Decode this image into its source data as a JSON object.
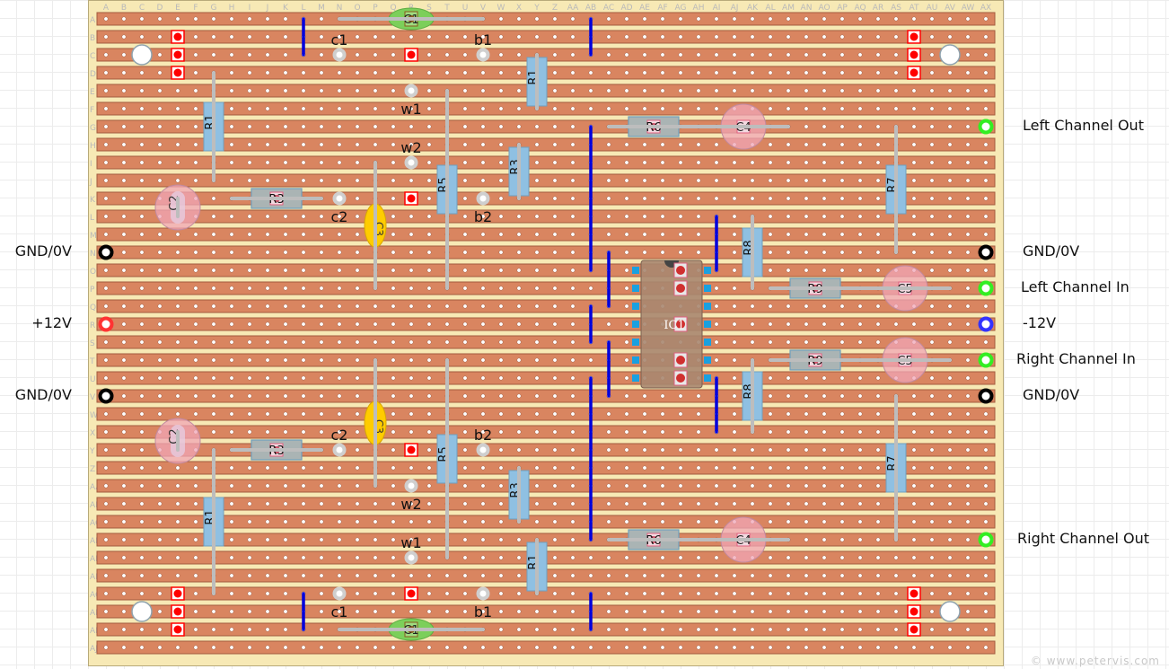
{
  "board": {
    "columns": [
      "A",
      "B",
      "C",
      "D",
      "E",
      "F",
      "G",
      "H",
      "I",
      "J",
      "K",
      "L",
      "M",
      "N",
      "O",
      "P",
      "Q",
      "R",
      "S",
      "T",
      "U",
      "V",
      "W",
      "X",
      "Y",
      "Z",
      "AA",
      "AB",
      "AC",
      "AD",
      "AE",
      "AF",
      "AG",
      "AH",
      "AI",
      "AJ",
      "AK",
      "AL",
      "AM",
      "AN",
      "AO",
      "AP",
      "AQ",
      "AR",
      "AS",
      "AT",
      "AU",
      "AV",
      "AW",
      "AX"
    ],
    "rows": [
      "A",
      "B",
      "C",
      "D",
      "E",
      "F",
      "G",
      "H",
      "I",
      "J",
      "K",
      "L",
      "M",
      "N",
      "O",
      "P",
      "Q",
      "R",
      "S",
      "T",
      "U",
      "V",
      "W",
      "X",
      "Y",
      "Z",
      "AA",
      "AB",
      "AC",
      "AD",
      "AE",
      "AF",
      "AG",
      "AH",
      "AI",
      "AJ"
    ],
    "colors": {
      "strip": "#d98560",
      "strip_border": "#a35a3e",
      "board": "#f7e9b5",
      "link": "#0000dd",
      "resistor": "#8fc0e2",
      "resistor_flat": "#aab4b4",
      "electrolytic": "#f0a6b6",
      "ceramic": "#ffcc00",
      "film": "#7ccf5a",
      "ic": "#a98770",
      "cut": "#ff0000"
    }
  },
  "external_labels": [
    {
      "text": "Left Channel Out",
      "side": "right",
      "row": "G"
    },
    {
      "text": "GND/0V",
      "side": "right",
      "row": "N"
    },
    {
      "text": "Left Channel In",
      "side": "right",
      "row": "P"
    },
    {
      "text": "-12V",
      "side": "right",
      "row": "R"
    },
    {
      "text": "Right Channel In",
      "side": "right",
      "row": "T"
    },
    {
      "text": "GND/0V",
      "side": "right",
      "row": "V"
    },
    {
      "text": "Right Channel Out",
      "side": "right",
      "row": "AD"
    },
    {
      "text": "GND/0V",
      "side": "left",
      "row": "N"
    },
    {
      "text": "+12V",
      "side": "left",
      "row": "R"
    },
    {
      "text": "GND/0V",
      "side": "left",
      "row": "V"
    }
  ],
  "terminals": [
    {
      "type": "ground",
      "col": "A",
      "row": "N",
      "color": "#000000"
    },
    {
      "type": "positive",
      "col": "A",
      "row": "R",
      "color": "#ff3333"
    },
    {
      "type": "ground",
      "col": "A",
      "row": "V",
      "color": "#000000"
    },
    {
      "type": "output",
      "col": "AX",
      "row": "G",
      "color": "#33ee22"
    },
    {
      "type": "ground",
      "col": "AX",
      "row": "N",
      "color": "#000000"
    },
    {
      "type": "input",
      "col": "AX",
      "row": "P",
      "color": "#33ee22"
    },
    {
      "type": "negative",
      "col": "AX",
      "row": "R",
      "color": "#3333ff"
    },
    {
      "type": "input",
      "col": "AX",
      "row": "T",
      "color": "#33ee22"
    },
    {
      "type": "ground",
      "col": "AX",
      "row": "V",
      "color": "#000000"
    },
    {
      "type": "output",
      "col": "AX",
      "row": "AD",
      "color": "#33ee22"
    }
  ],
  "track_cuts": [
    {
      "col": "E",
      "row": "B"
    },
    {
      "col": "E",
      "row": "C"
    },
    {
      "col": "E",
      "row": "D"
    },
    {
      "col": "R",
      "row": "C"
    },
    {
      "col": "AT",
      "row": "B"
    },
    {
      "col": "AT",
      "row": "C"
    },
    {
      "col": "AT",
      "row": "D"
    },
    {
      "col": "R",
      "row": "K"
    },
    {
      "col": "R",
      "row": "Y"
    },
    {
      "col": "E",
      "row": "AG"
    },
    {
      "col": "E",
      "row": "AH"
    },
    {
      "col": "E",
      "row": "AI"
    },
    {
      "col": "R",
      "row": "AG"
    },
    {
      "col": "AT",
      "row": "AG"
    },
    {
      "col": "AT",
      "row": "AH"
    },
    {
      "col": "AT",
      "row": "AI"
    }
  ],
  "mounting_holes": [
    {
      "col": "C",
      "row": "C"
    },
    {
      "col": "AV",
      "row": "C"
    },
    {
      "col": "C",
      "row": "AH"
    },
    {
      "col": "AV",
      "row": "AH"
    }
  ],
  "wire_links": [
    {
      "col": "L",
      "from": "A",
      "to": "C"
    },
    {
      "col": "AB",
      "from": "A",
      "to": "C"
    },
    {
      "col": "AB",
      "from": "G",
      "to": "O"
    },
    {
      "col": "AC",
      "from": "N",
      "to": "Q"
    },
    {
      "col": "AI",
      "from": "L",
      "to": "O"
    },
    {
      "col": "AB",
      "from": "Q",
      "to": "S"
    },
    {
      "col": "AC",
      "from": "S",
      "to": "V"
    },
    {
      "col": "AI",
      "from": "U",
      "to": "X"
    },
    {
      "col": "AB",
      "from": "U",
      "to": "AD"
    },
    {
      "col": "L",
      "from": "AG",
      "to": "AI"
    },
    {
      "col": "AB",
      "from": "AG",
      "to": "AI"
    }
  ],
  "offboard_pads": [
    {
      "label": "c1",
      "col": "N",
      "row": "C",
      "label_pos": "above"
    },
    {
      "label": "b1",
      "col": "V",
      "row": "C",
      "label_pos": "above"
    },
    {
      "label": "w1",
      "col": "R",
      "row": "E",
      "label_pos": "below"
    },
    {
      "label": "w2",
      "col": "R",
      "row": "I",
      "label_pos": "above"
    },
    {
      "label": "c2",
      "col": "N",
      "row": "K",
      "label_pos": "below"
    },
    {
      "label": "b2",
      "col": "V",
      "row": "K",
      "label_pos": "below"
    },
    {
      "label": "c2",
      "col": "N",
      "row": "Y",
      "label_pos": "above"
    },
    {
      "label": "b2",
      "col": "V",
      "row": "Y",
      "label_pos": "above"
    },
    {
      "label": "w2",
      "col": "R",
      "row": "AA",
      "label_pos": "below"
    },
    {
      "label": "w1",
      "col": "R",
      "row": "AE",
      "label_pos": "above"
    },
    {
      "label": "c1",
      "col": "N",
      "row": "AG",
      "label_pos": "below"
    },
    {
      "label": "b1",
      "col": "V",
      "row": "AG",
      "label_pos": "below"
    }
  ],
  "components": [
    {
      "ref": "R1",
      "kind": "resistor",
      "orient": "v",
      "col": "G",
      "from": "D",
      "to": "J"
    },
    {
      "ref": "R1",
      "kind": "resistor",
      "orient": "v",
      "col": "Y",
      "from": "C",
      "to": "F"
    },
    {
      "ref": "R3",
      "kind": "resistor",
      "orient": "v",
      "col": "X",
      "from": "H",
      "to": "K"
    },
    {
      "ref": "R5",
      "kind": "resistor",
      "orient": "v",
      "col": "T",
      "from": "E",
      "to": "P"
    },
    {
      "ref": "R7",
      "kind": "resistor",
      "orient": "v",
      "col": "AS",
      "from": "G",
      "to": "N"
    },
    {
      "ref": "R8",
      "kind": "resistor",
      "orient": "v",
      "col": "AK",
      "from": "L",
      "to": "P"
    },
    {
      "ref": "R3",
      "kind": "resistor-flat",
      "orient": "h",
      "row": "K",
      "from": "I",
      "to": "L"
    },
    {
      "ref": "R6",
      "kind": "resistor-flat",
      "orient": "h",
      "row": "G",
      "from": "AD",
      "to": "AG"
    },
    {
      "ref": "R9",
      "kind": "resistor-flat",
      "orient": "h",
      "row": "P",
      "from": "AM",
      "to": "AP"
    },
    {
      "ref": "C1",
      "kind": "film",
      "orient": "h",
      "row": "A",
      "from": "O",
      "to": "U"
    },
    {
      "ref": "C2",
      "kind": "electrolytic",
      "orient": "v",
      "col": "E",
      "from": "K",
      "to": "L"
    },
    {
      "ref": "C3",
      "kind": "ceramic",
      "orient": "v",
      "col": "P",
      "from": "I",
      "to": "P"
    },
    {
      "ref": "C4",
      "kind": "electrolytic",
      "orient": "h",
      "row": "G",
      "from": "AI",
      "to": "AL"
    },
    {
      "ref": "C5",
      "kind": "electrolytic",
      "orient": "h",
      "row": "P",
      "from": "AR",
      "to": "AU"
    },
    {
      "ref": "R9",
      "kind": "resistor-flat",
      "orient": "h",
      "row": "T",
      "from": "AM",
      "to": "AP"
    },
    {
      "ref": "C5",
      "kind": "electrolytic",
      "orient": "h",
      "row": "T",
      "from": "AR",
      "to": "AU"
    },
    {
      "ref": "R8",
      "kind": "resistor",
      "orient": "v",
      "col": "AK",
      "from": "T",
      "to": "X"
    },
    {
      "ref": "R7",
      "kind": "resistor",
      "orient": "v",
      "col": "AS",
      "from": "V",
      "to": "AD"
    },
    {
      "ref": "C3",
      "kind": "ceramic",
      "orient": "v",
      "col": "P",
      "from": "T",
      "to": "AA"
    },
    {
      "ref": "R5",
      "kind": "resistor",
      "orient": "v",
      "col": "T",
      "from": "T",
      "to": "AE"
    },
    {
      "ref": "C2",
      "kind": "electrolytic",
      "orient": "v",
      "col": "E",
      "from": "X",
      "to": "Y"
    },
    {
      "ref": "R3",
      "kind": "resistor-flat",
      "orient": "h",
      "row": "Y",
      "from": "I",
      "to": "L"
    },
    {
      "ref": "R3",
      "kind": "resistor",
      "orient": "v",
      "col": "X",
      "from": "Z",
      "to": "AC"
    },
    {
      "ref": "R1",
      "kind": "resistor",
      "orient": "v",
      "col": "G",
      "from": "Y",
      "to": "AG"
    },
    {
      "ref": "R6",
      "kind": "resistor-flat",
      "orient": "h",
      "row": "AD",
      "from": "AD",
      "to": "AG"
    },
    {
      "ref": "C4",
      "kind": "electrolytic",
      "orient": "h",
      "row": "AD",
      "from": "AI",
      "to": "AL"
    },
    {
      "ref": "R1",
      "kind": "resistor",
      "orient": "v",
      "col": "Y",
      "from": "AD",
      "to": "AG"
    },
    {
      "ref": "C1",
      "kind": "film",
      "orient": "h",
      "row": "AI",
      "from": "O",
      "to": "U"
    }
  ],
  "ic": {
    "ref": "IC1",
    "col_left": "AE",
    "col_right": "AH",
    "row_top": "O",
    "row_bottom": "U",
    "cut_rows": [
      "O",
      "P",
      "R",
      "T",
      "U"
    ]
  },
  "watermark": "© www.petervis.com"
}
